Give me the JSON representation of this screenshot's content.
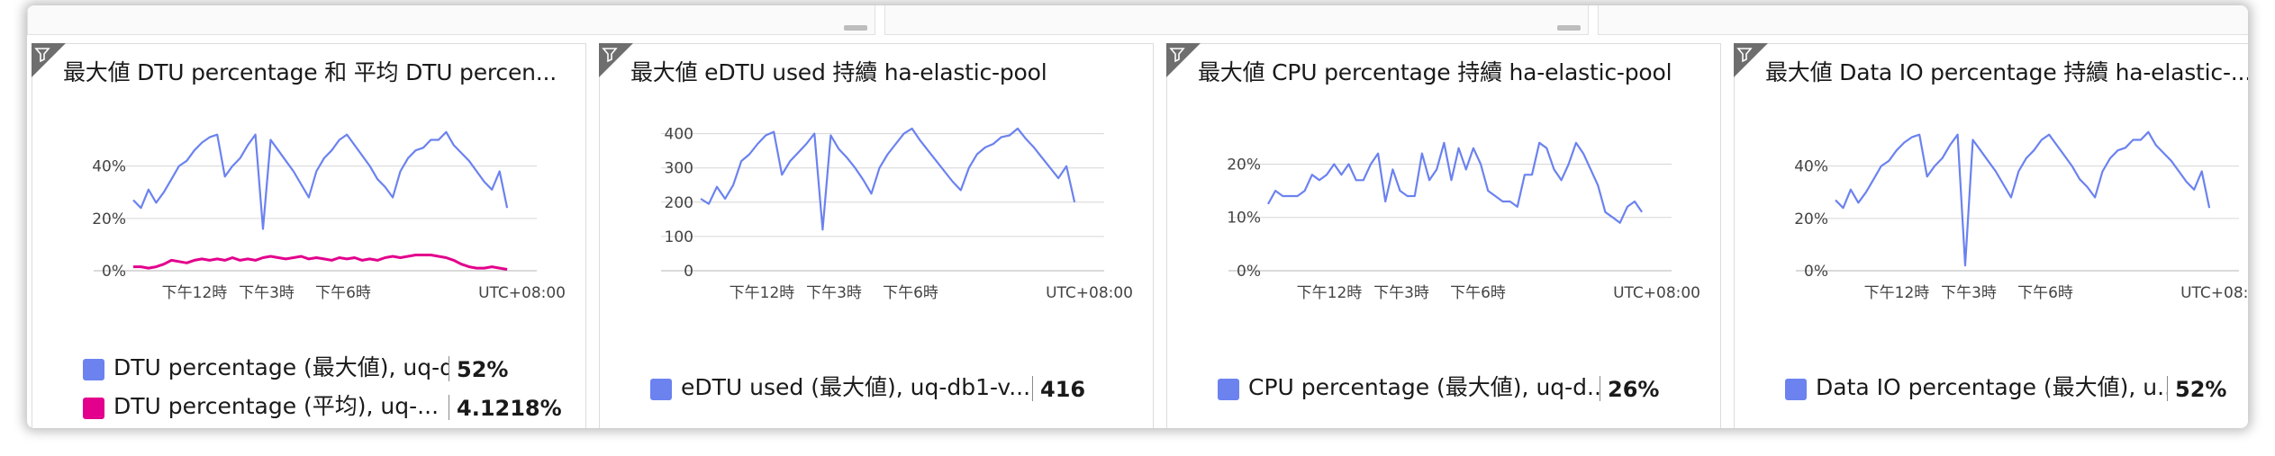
{
  "colors": {
    "blue": "#6b82ef",
    "pink": "#e3008c",
    "grid": "#d6d6d6",
    "axis": "#b5b5b5"
  },
  "icons": {
    "filter": "filter-icon"
  },
  "tiles": [
    {
      "title": "最大値 DTU percentage 和 平均 DTU percen...",
      "legend": [
        {
          "name": "DTU percentage (最大値), uq-d...",
          "value": "52%",
          "color": "#6b82ef"
        },
        {
          "name": "DTU percentage (平均), uq-...",
          "value": "4.1218%",
          "color": "#e3008c"
        }
      ]
    },
    {
      "title": "最大値 eDTU used 持續 ha-elastic-pool",
      "legend": [
        {
          "name": "eDTU used (最大値), uq-db1-v...",
          "value": "416",
          "color": "#6b82ef"
        }
      ]
    },
    {
      "title": "最大値 CPU percentage 持續 ha-elastic-pool",
      "legend": [
        {
          "name": "CPU percentage (最大値), uq-d...",
          "value": "26%",
          "color": "#6b82ef"
        }
      ]
    },
    {
      "title": "最大値 Data IO percentage 持續 ha-elastic-...",
      "legend": [
        {
          "name": "Data IO percentage (最大値), u...",
          "value": "52%",
          "color": "#6b82ef"
        }
      ]
    }
  ],
  "chart_data": [
    {
      "type": "line",
      "yticks": [
        "0%",
        "20%",
        "40%"
      ],
      "ylim": [
        0,
        55
      ],
      "x_ticks": [
        "下午12時",
        "下午3時",
        "下午6時"
      ],
      "timezone": "UTC+08:00",
      "series": [
        {
          "name": "DTU percentage (最大値), uq-d...",
          "color": "#6b82ef",
          "values": [
            27,
            24,
            31,
            26,
            30,
            35,
            40,
            42,
            46,
            49,
            51,
            52,
            36,
            40,
            43,
            48,
            52,
            16,
            50,
            46,
            42,
            38,
            33,
            28,
            38,
            43,
            46,
            50,
            52,
            48,
            44,
            40,
            35,
            32,
            28,
            38,
            43,
            46,
            47,
            50,
            50,
            53,
            48,
            45,
            42,
            38,
            34,
            31,
            38,
            24
          ]
        },
        {
          "name": "DTU percentage (平均), uq-...",
          "color": "#e3008c",
          "values": [
            1.5,
            1.5,
            1,
            1.5,
            2.5,
            4,
            3.5,
            3,
            4,
            4.5,
            4,
            4.5,
            4,
            5,
            4,
            4.5,
            4,
            5,
            5.5,
            5,
            4.5,
            5,
            5.5,
            4.5,
            5,
            4.5,
            4,
            5,
            4.5,
            5,
            4,
            4.5,
            4,
            5,
            5.5,
            5,
            5.5,
            6,
            6,
            6,
            5.5,
            5,
            4,
            2.5,
            1.5,
            1,
            1,
            1.5,
            1,
            0.5
          ]
        }
      ]
    },
    {
      "type": "line",
      "yticks": [
        "0",
        "100",
        "200",
        "300",
        "400"
      ],
      "ylim": [
        0,
        420
      ],
      "x_ticks": [
        "下午12時",
        "下午3時",
        "下午6時"
      ],
      "timezone": "UTC+08:00",
      "series": [
        {
          "name": "eDTU used (最大値), uq-db1-v...",
          "color": "#6b82ef",
          "values": [
            210,
            195,
            245,
            210,
            250,
            320,
            340,
            370,
            395,
            405,
            280,
            320,
            345,
            370,
            400,
            120,
            395,
            355,
            330,
            300,
            265,
            225,
            300,
            340,
            370,
            400,
            415,
            380,
            350,
            320,
            290,
            260,
            235,
            300,
            340,
            360,
            370,
            390,
            395,
            415,
            385,
            360,
            330,
            300,
            270,
            305,
            200
          ]
        }
      ]
    },
    {
      "type": "line",
      "yticks": [
        "0%",
        "10%",
        "20%"
      ],
      "ylim": [
        0,
        27
      ],
      "x_ticks": [
        "下午12時",
        "下午3時",
        "下午6時"
      ],
      "timezone": "UTC+08:00",
      "series": [
        {
          "name": "CPU percentage (最大値), uq-d...",
          "color": "#6b82ef",
          "values": [
            12.5,
            15,
            14,
            14,
            14,
            15,
            18,
            17,
            18,
            20,
            18,
            20,
            17,
            17,
            20,
            22,
            13,
            19,
            15,
            14,
            14,
            22,
            17,
            19,
            24,
            17,
            23,
            19,
            23,
            20,
            15,
            14,
            13,
            13,
            12,
            18,
            18,
            24,
            23,
            19,
            17,
            20,
            24,
            22,
            19,
            16,
            11,
            10,
            9,
            12,
            13,
            11
          ]
        }
      ]
    },
    {
      "type": "line",
      "yticks": [
        "0%",
        "20%",
        "40%"
      ],
      "ylim": [
        0,
        55
      ],
      "x_ticks": [
        "下午12時",
        "下午3時",
        "下午6時"
      ],
      "timezone": "UTC+08:00",
      "series": [
        {
          "name": "Data IO percentage (最大値), u...",
          "color": "#6b82ef",
          "values": [
            27,
            24,
            31,
            26,
            30,
            35,
            40,
            42,
            46,
            49,
            51,
            52,
            36,
            40,
            43,
            48,
            52,
            2,
            50,
            46,
            42,
            38,
            33,
            28,
            38,
            43,
            46,
            50,
            52,
            48,
            44,
            40,
            35,
            32,
            28,
            38,
            43,
            46,
            47,
            50,
            50,
            53,
            48,
            45,
            42,
            38,
            34,
            31,
            38,
            24
          ]
        }
      ]
    }
  ]
}
